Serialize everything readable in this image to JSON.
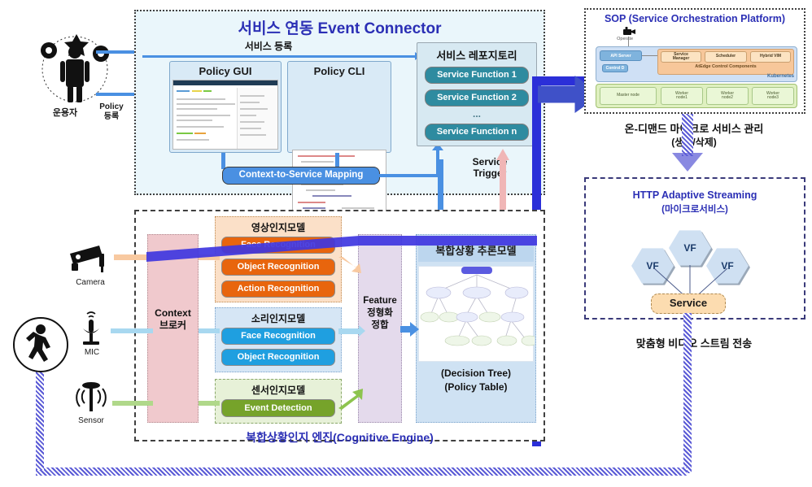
{
  "left_actors": {
    "operator_label": "운용자",
    "policy_register_label": "Policy\n등록",
    "operator_icon": "person-gears-icon",
    "camera_label": "Camera",
    "mic_label": "MIC",
    "sensor_label": "Sensor",
    "camera_icon": "cctv-camera-icon",
    "mic_icon": "microphone-icon",
    "sensor_icon": "motion-sensor-icon",
    "person_icon": "walking-person-icon"
  },
  "event_connector": {
    "title": "서비스 연동 Event Connector",
    "service_register_label": "서비스 등록",
    "policy_gui_title": "Policy GUI",
    "policy_cli_title": "Policy CLI",
    "context_mapping_label": "Context-to-Service Mapping",
    "service_trigger_label": "Service\nTrigger",
    "repository": {
      "title": "서비스 레포지토리",
      "functions": [
        "Service Function 1",
        "Service Function 2",
        "...",
        "Service Function n"
      ]
    }
  },
  "cognitive_engine": {
    "title": "복합상황인지 엔진(Cognitive Engine)",
    "context_broker": "Context\n브로커",
    "feature_box": "Feature\n정형화\n정합",
    "models": [
      {
        "title": "영상인지모델",
        "items": [
          "Face Recognition",
          "Object Recognition",
          "Action Recognition"
        ],
        "color": "#e8650d"
      },
      {
        "title": "소리인지모델",
        "items": [
          "Face Recognition",
          "Object Recognition"
        ],
        "color": "#1f9fe0"
      },
      {
        "title": "센서인지모델",
        "items": [
          "Event Detection"
        ],
        "color": "#76a32a"
      }
    ],
    "inference": {
      "title": "복합상황 추론모델",
      "caption_line1": "(Decision Tree)",
      "caption_line2": "(Policy Table)",
      "tree_icon": "decision-tree-icon"
    }
  },
  "sop": {
    "title": "SOP (Service Orchestration Platform)",
    "operate_label": "Operate",
    "operator_icon": "operator-icon",
    "api_server": "API Server",
    "control_d": "Control D",
    "components": [
      "Service\nManager",
      "Scheduler",
      "Hybrid VIM"
    ],
    "components_caption": "AtEdge Control Components",
    "kubernetes_label": "Kubernetes",
    "nodes": [
      "Master node",
      "Worker\nnode1",
      "Worker\nnode2",
      "Worker\nnode3"
    ]
  },
  "right_annotations": {
    "ondemand_line1": "온-디맨드 마이크로 서비스 관리",
    "ondemand_line2": "(생성/삭제)",
    "stream_label": "맞춤형 비디오 스트림 전송"
  },
  "has": {
    "title_line1": "HTTP Adaptive Streaming",
    "title_line2": "(마이크로서비스)",
    "vf_label": "VF",
    "vf_count": 3,
    "service_label": "Service"
  },
  "colors": {
    "accent_blue": "#2b2fb5",
    "arrow_blue": "#4a90e2",
    "thick_blue": "#2b2fd8",
    "teal": "#2e8ba0",
    "orange": "#e8650d",
    "sky": "#1f9fe0",
    "green": "#76a32a",
    "pink_arrow": "#f0b6b6",
    "dot_purple": "#5b5bd6"
  }
}
